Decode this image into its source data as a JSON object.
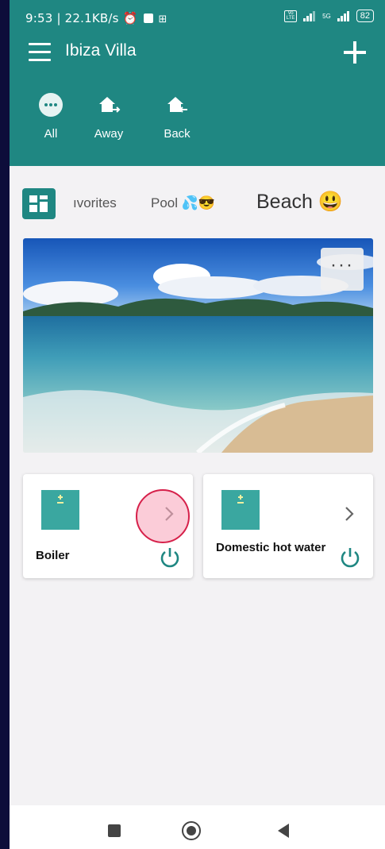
{
  "status_bar": {
    "left_text": "9:53 | 22.1KB/s",
    "network": "5G",
    "battery": "82",
    "icons": [
      "alarm-icon",
      "notification-icon",
      "app-icon",
      "volte-icon",
      "signal-icon",
      "battery-icon"
    ]
  },
  "header": {
    "title": "Ibiza Villa",
    "bg_color": "#1f8782",
    "menu_icon": "hamburger-icon",
    "add_icon": "plus-icon",
    "scenes": [
      {
        "label": "All",
        "icon": "more-dots-icon"
      },
      {
        "label": "Away",
        "icon": "home-away-icon"
      },
      {
        "label": "Back",
        "icon": "home-back-icon"
      }
    ]
  },
  "tabs": {
    "grid_icon": "dashboard-grid-icon",
    "items": [
      {
        "label": "ıvorites",
        "active": false
      },
      {
        "label": "Pool 💦😎",
        "active": false
      },
      {
        "label": "Beach 😃",
        "active": true
      }
    ]
  },
  "hero": {
    "image": "beach-landscape",
    "menu_label": "···"
  },
  "devices": [
    {
      "name": "Boiler",
      "icon": "boiler-icon",
      "power_icon": "power-icon",
      "chevron_icon": "chevron-right-icon"
    },
    {
      "name": "Domestic hot water",
      "icon": "water-heater-icon",
      "power_icon": "power-icon",
      "chevron_icon": "chevron-right-icon"
    }
  ],
  "navbar": {
    "icons": [
      "recent-apps-icon",
      "home-icon",
      "back-icon"
    ]
  },
  "colors": {
    "accent": "#1f8782",
    "device_icon": "#3aa7a0",
    "background": "#f3f2f4",
    "touch_indicator": "#d6204a"
  }
}
